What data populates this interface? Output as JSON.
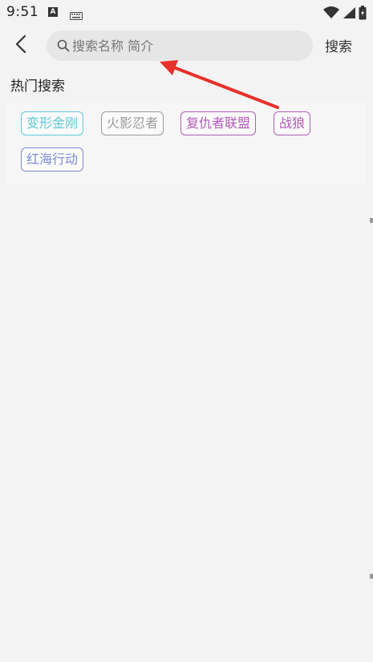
{
  "status_bar": {
    "time": "9:51",
    "icons": [
      "notification-a-icon",
      "keyboard-icon",
      "wifi-icon",
      "signal-icon",
      "battery-icon"
    ]
  },
  "header": {
    "back_icon": "chevron-left-icon",
    "search": {
      "placeholder": "搜索名称 简介",
      "value": ""
    },
    "search_button": "搜索"
  },
  "hot_search": {
    "title": "热门搜索",
    "tags": [
      {
        "label": "变形金刚",
        "color": "#5bc8d6"
      },
      {
        "label": "火影忍者",
        "color": "#9a9a9a"
      },
      {
        "label": "复仇者联盟",
        "color": "#b15bb6"
      },
      {
        "label": "战狼",
        "color": "#b15bb6"
      },
      {
        "label": "红海行动",
        "color": "#7d8ad8"
      }
    ]
  },
  "annotation": {
    "color": "#e8302a"
  }
}
